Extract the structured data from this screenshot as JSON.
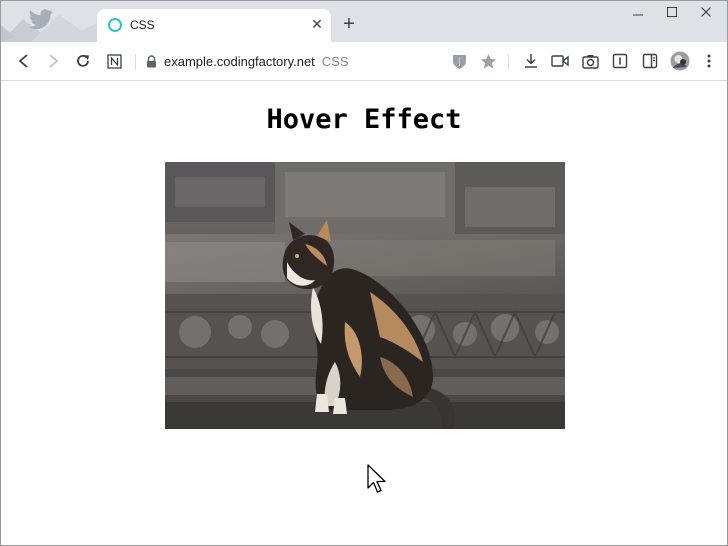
{
  "browser": {
    "tab": {
      "title": "CSS"
    },
    "address": {
      "domain": "example.codingfactory.net",
      "page_title": "CSS"
    }
  },
  "page": {
    "heading": "Hover Effect",
    "image": {
      "subject": "calico-cat-on-stone-ruins"
    }
  },
  "icons": [
    "twitter-bird-icon",
    "tab-favicon-icon",
    "close-icon",
    "plus-icon",
    "minimize-icon",
    "maximize-icon",
    "back-icon",
    "forward-icon",
    "reload-icon",
    "notion-icon",
    "lock-icon",
    "shield-icon",
    "star-icon",
    "download-icon",
    "video-icon",
    "camera-icon",
    "reader-icon",
    "sidebar-icon",
    "avatar",
    "more-icon",
    "cursor-icon"
  ],
  "colors": {
    "tabstrip": "#dee1e6",
    "favicon": "#2ec4b6",
    "text": "#202124",
    "muted": "#80868b"
  }
}
